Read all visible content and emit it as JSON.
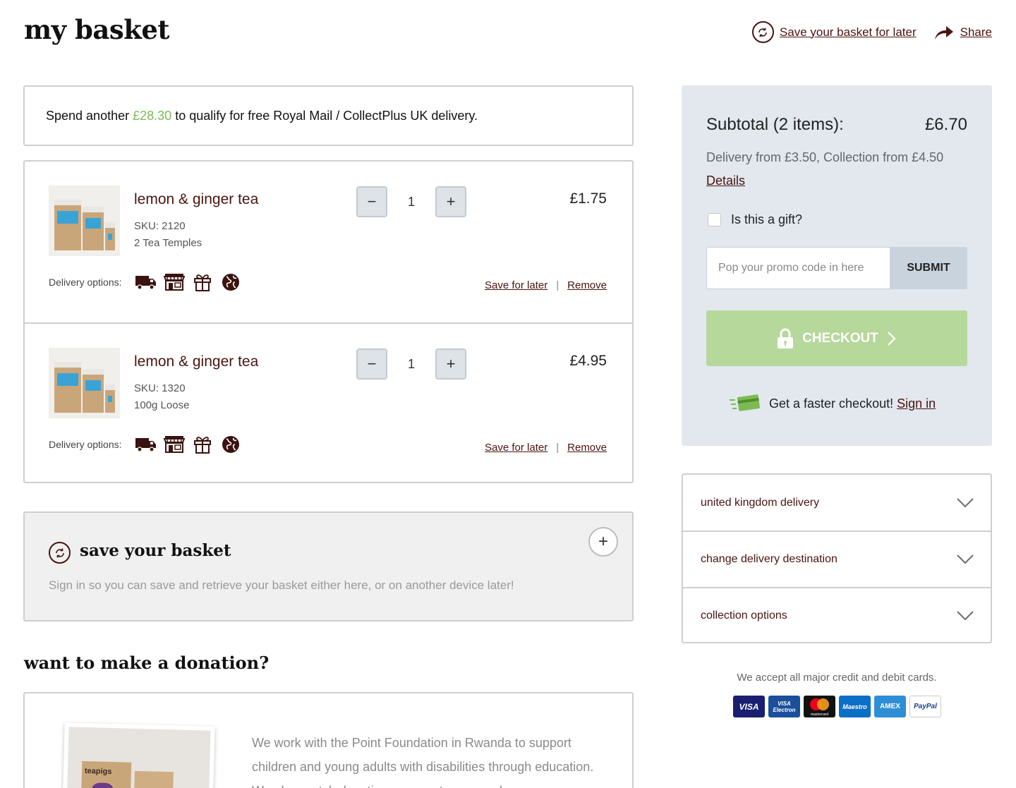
{
  "header": {
    "title": "my basket",
    "save_later_label": "Save your basket for later",
    "share_label": "Share"
  },
  "notice": {
    "prefix": "Spend another",
    "amount": "£28.30",
    "suffix": "to qualify for free Royal Mail / CollectPlus UK delivery."
  },
  "items": [
    {
      "name": "lemon & ginger tea",
      "sku": "SKU: 2120",
      "variant": "2 Tea Temples",
      "qty": "1",
      "price": "£1.75",
      "delivery_label": "Delivery options:",
      "save_later": "Save for later",
      "remove": "Remove"
    },
    {
      "name": "lemon & ginger tea",
      "sku": "SKU: 1320",
      "variant": "100g Loose",
      "qty": "1",
      "price": "£4.95",
      "delivery_label": "Delivery options:",
      "save_later": "Save for later",
      "remove": "Remove"
    }
  ],
  "qty_controls": {
    "minus": "−",
    "plus": "+"
  },
  "delivery_icons": [
    "truck-icon",
    "store-icon",
    "gift-icon",
    "globe-icon"
  ],
  "save_basket": {
    "title": "save your basket",
    "text": "Sign in so you can save and retrieve your basket either here, or on another device later!",
    "expand": "+"
  },
  "donation": {
    "title": "want to make a donation?",
    "text": "We work with the Point Foundation in Rwanda to support children and young adults with disabilities through education. We also match donations our customers make",
    "photo_brand": "teapigs"
  },
  "summary": {
    "subtotal_label": "Subtotal (2 items):",
    "subtotal_value": "£6.70",
    "delivery_info": "Delivery from £3.50, Collection from £4.50",
    "details_link": "Details",
    "gift_label": "Is this a gift?",
    "promo_placeholder": "Pop your promo code in here",
    "promo_value": "",
    "submit_label": "SUBMIT",
    "checkout_label": "CHECKOUT",
    "faster_text": "Get a faster checkout!",
    "signin_label": "Sign in"
  },
  "accordion": [
    {
      "label": "united kingdom delivery"
    },
    {
      "label": "change delivery destination"
    },
    {
      "label": "collection options"
    }
  ],
  "payment": {
    "text": "We accept all major credit and debit cards.",
    "cards": [
      "VISA",
      "VISA Electron",
      "mastercard",
      "Maestro",
      "AMEX",
      "PayPal"
    ]
  },
  "colors": {
    "brand": "#4a1410",
    "accent_green": "#7dbb52",
    "checkout_green": "#b6d89b",
    "summary_bg": "#e2e8ee"
  }
}
